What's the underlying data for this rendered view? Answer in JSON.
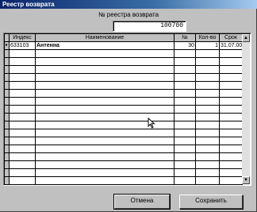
{
  "window": {
    "title": "Реестр возврата"
  },
  "form": {
    "reestr_label": "№ реестра возврата",
    "reestr_value": "100700"
  },
  "table": {
    "columns": [
      "Индекс",
      "Наименование",
      "№",
      "Кол-во",
      "Срок"
    ],
    "rows": [
      [
        "633103",
        "Антенна",
        "30",
        "1",
        "31.07.00"
      ]
    ]
  },
  "buttons": {
    "cancel_label": "Отмена",
    "save_label": "Сохранить"
  }
}
